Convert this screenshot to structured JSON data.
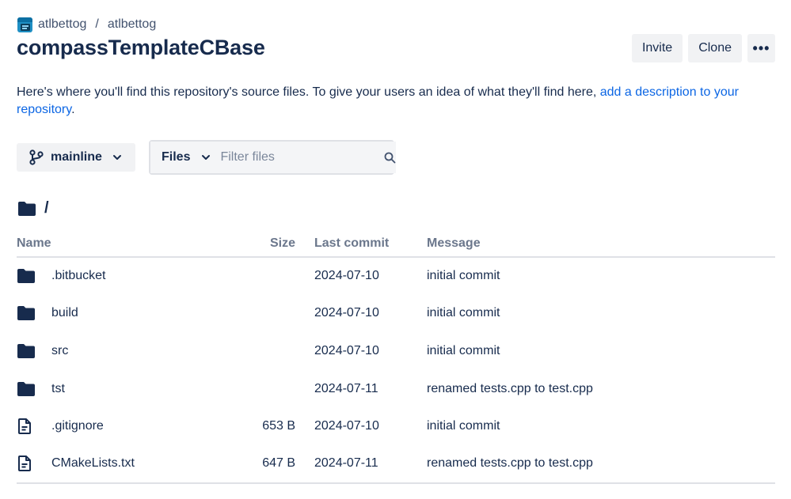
{
  "breadcrumb": {
    "workspace": "atlbettog",
    "separator": "/",
    "project": "atlbettog"
  },
  "repo": {
    "title": "compassTemplateCBase"
  },
  "actions": {
    "invite_label": "Invite",
    "clone_label": "Clone",
    "more_label": "•••"
  },
  "description": {
    "text": "Here's where you'll find this repository's source files. To give your users an idea of what they'll find here, ",
    "link_text": "add a description to your repository",
    "end": "."
  },
  "branch": {
    "label": "mainline"
  },
  "filter": {
    "type_label": "Files",
    "placeholder": "Filter files"
  },
  "path": {
    "current": "/"
  },
  "table": {
    "headers": {
      "name": "Name",
      "size": "Size",
      "last_commit": "Last commit",
      "message": "Message"
    },
    "rows": [
      {
        "type": "folder",
        "name": ".bitbucket",
        "size": "",
        "date": "2024-07-10",
        "message": "initial commit"
      },
      {
        "type": "folder",
        "name": "build",
        "size": "",
        "date": "2024-07-10",
        "message": "initial commit"
      },
      {
        "type": "folder",
        "name": "src",
        "size": "",
        "date": "2024-07-10",
        "message": "initial commit"
      },
      {
        "type": "folder",
        "name": "tst",
        "size": "",
        "date": "2024-07-11",
        "message": "renamed tests.cpp to test.cpp"
      },
      {
        "type": "file",
        "name": ".gitignore",
        "size": "653 B",
        "date": "2024-07-10",
        "message": "initial commit"
      },
      {
        "type": "file",
        "name": "CMakeLists.txt",
        "size": "647 B",
        "date": "2024-07-11",
        "message": "renamed tests.cpp to test.cpp"
      }
    ]
  },
  "icons": {
    "folder": "folder-icon",
    "file": "file-icon",
    "branch": "branch-icon",
    "search": "search-icon",
    "chevron": "chevron-down-icon"
  },
  "colors": {
    "text": "#172b4d",
    "link": "#0c66e4",
    "muted": "#6b778c",
    "button_bg": "#f1f2f4",
    "divider": "#dfe1e6"
  }
}
